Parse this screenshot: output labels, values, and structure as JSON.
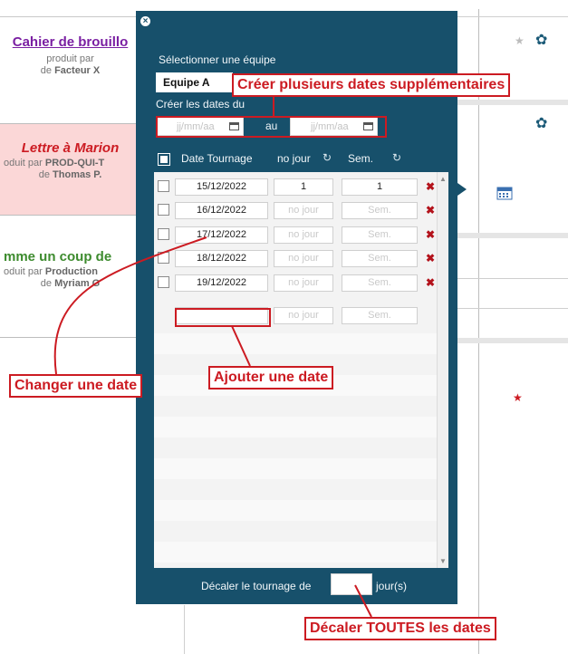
{
  "background": {
    "cards": [
      {
        "title": "Cahier de brouillo",
        "title_color": "#7a1fa2",
        "line1": "produit par",
        "line2_prefix": "de",
        "line2_bold": "Facteur X"
      },
      {
        "title": "Lettre à Marion",
        "title_color": "#cc1b22",
        "line1_prefix": "oduit par",
        "line1_bold": "PROD-QUI-T",
        "line2_prefix": "de",
        "line2_bold": "Thomas P."
      },
      {
        "title": "mme un coup de",
        "title_color": "#3d8b2e",
        "line1_prefix": "oduit par",
        "line1_bold": "Production",
        "line2_prefix": "de",
        "line2_bold": "Myriam G"
      }
    ]
  },
  "popup": {
    "close_icon": "×",
    "select_team_label": "Sélectionner une équipe",
    "team_value": "Equipe A",
    "create_dates_label": "Créer les dates du",
    "from_placeholder": "jj/mm/aa",
    "between_label": "au",
    "to_placeholder": "jj/mm/aa",
    "header": {
      "date_col": "Date Tournage",
      "day_col": "no jour",
      "week_col": "Sem.",
      "refresh_icon": "↻"
    },
    "rows": [
      {
        "date": "15/12/2022",
        "day": "1",
        "week": "1",
        "day_placeholder": false,
        "delete": "✖"
      },
      {
        "date": "16/12/2022",
        "day": "no jour",
        "week": "Sem.",
        "day_placeholder": true,
        "delete": "✖"
      },
      {
        "date": "17/12/2022",
        "day": "no jour",
        "week": "Sem.",
        "day_placeholder": true,
        "delete": "✖"
      },
      {
        "date": "18/12/2022",
        "day": "no jour",
        "week": "Sem.",
        "day_placeholder": true,
        "delete": "✖"
      },
      {
        "date": "19/12/2022",
        "day": "no jour",
        "week": "Sem.",
        "day_placeholder": true,
        "delete": "✖"
      }
    ],
    "new_row": {
      "day_placeholder": "no jour",
      "week_placeholder": "Sem."
    },
    "shift_label": "Décaler le tournage de",
    "shift_unit": "jour(s)"
  },
  "annotations": {
    "create_more": "Créer plusieurs dates supplémentaires",
    "change_date": "Changer une date",
    "add_date": "Ajouter une date",
    "shift_all": "Décaler TOUTES les dates"
  },
  "colors": {
    "popup_bg": "#17506b",
    "annotation_red": "#cc1b22",
    "gear": "#1c5b78"
  }
}
